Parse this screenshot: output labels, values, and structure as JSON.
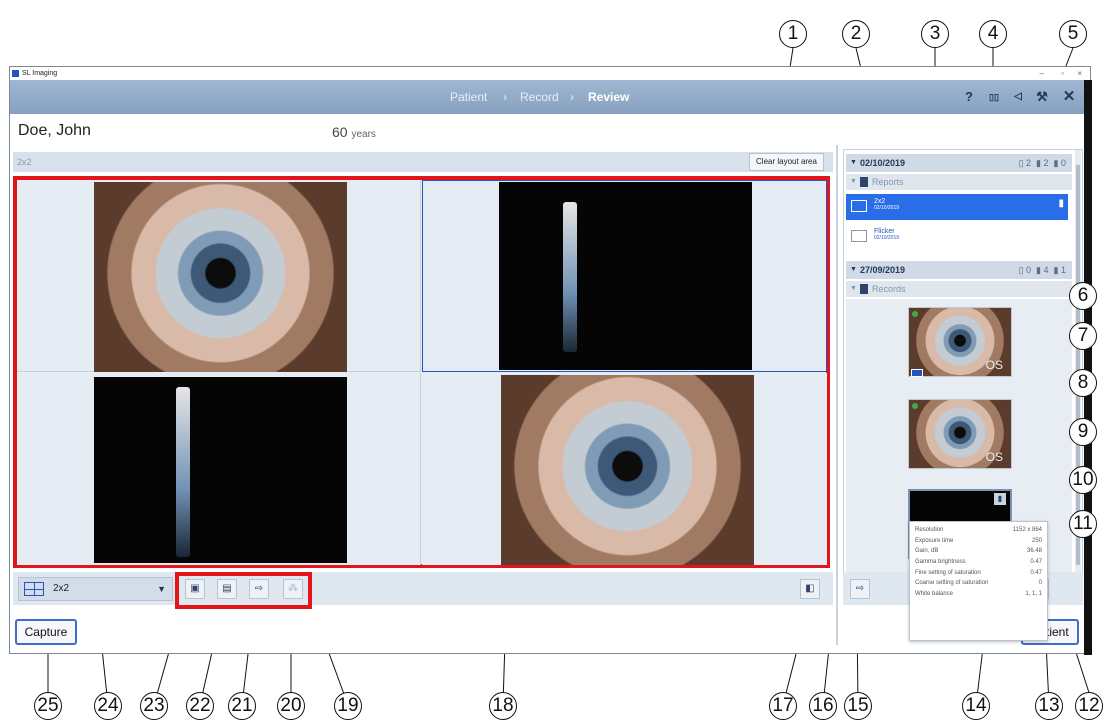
{
  "window": {
    "title": "SL Imaging",
    "min": "–",
    "max": "▫",
    "close": "×"
  },
  "nav": {
    "steps": [
      "Patient",
      "Record",
      "Review"
    ],
    "separator": "›"
  },
  "nav_icons": [
    "help-icon",
    "compare-icon",
    "speaker-icon",
    "wrench-icon",
    "close-icon"
  ],
  "patient": {
    "name": "Doe, John",
    "age": "60",
    "age_unit": "years"
  },
  "layout": {
    "name": "2x2",
    "clear_label": "Clear layout area"
  },
  "toolbar": {
    "dropdown_value": "2x2",
    "capture_label": "Capture",
    "patient_label": "Patient"
  },
  "panel": {
    "group1": {
      "date": "02/10/2019",
      "counts": [
        "2",
        "2",
        "0"
      ],
      "section": "Reports",
      "reports": [
        {
          "name": "2x2",
          "date": "02/10/2019"
        },
        {
          "name": "Flicker",
          "date": "02/10/2019"
        }
      ]
    },
    "group2": {
      "date": "27/09/2019",
      "counts": [
        "0",
        "4",
        "1"
      ],
      "section": "Records"
    },
    "thumb_labels": [
      "OS",
      "OS"
    ]
  },
  "tooltip": [
    {
      "k": "Resolution",
      "v": "1152 x 864"
    },
    {
      "k": "Exposure time",
      "v": "250"
    },
    {
      "k": "Gain, dB",
      "v": "36.48"
    },
    {
      "k": "Gamma brightness",
      "v": "0.47"
    },
    {
      "k": "Fine setting of saturation",
      "v": "0.47"
    },
    {
      "k": "Coarse setting of saturation",
      "v": "0"
    },
    {
      "k": "White balance",
      "v": "1, 1, 1"
    }
  ],
  "callouts": [
    "1",
    "2",
    "3",
    "4",
    "5",
    "6",
    "7",
    "8",
    "9",
    "10",
    "11",
    "12",
    "13",
    "14",
    "15",
    "16",
    "17",
    "18",
    "19",
    "20",
    "21",
    "22",
    "23",
    "24",
    "25"
  ]
}
